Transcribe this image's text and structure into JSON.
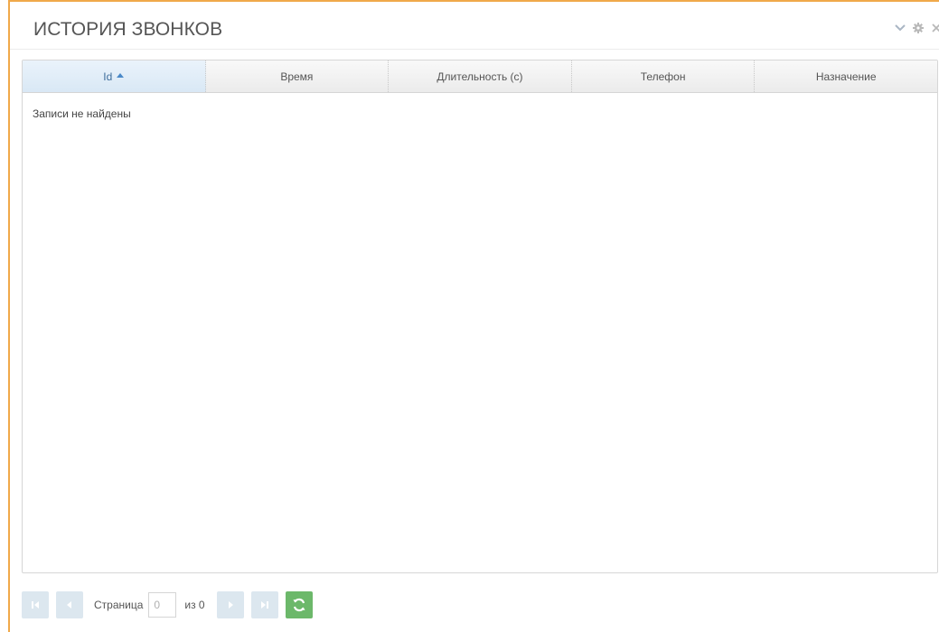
{
  "panel": {
    "title": "ИСТОРИЯ ЗВОНКОВ",
    "tools": [
      {
        "icon": "chevron-down-icon"
      },
      {
        "icon": "gear-icon"
      },
      {
        "icon": "close-icon"
      }
    ]
  },
  "grid": {
    "columns": [
      {
        "label": "Id",
        "sorted": "asc"
      },
      {
        "label": "Время"
      },
      {
        "label": "Длительность (с)"
      },
      {
        "label": "Телефон"
      },
      {
        "label": "Назначение"
      }
    ],
    "rows": [],
    "empty_message": "Записи не найдены"
  },
  "pager": {
    "page_label": "Страница",
    "page_value": "0",
    "of_label": "из 0",
    "buttons": {
      "first": "first-page-icon",
      "prev": "prev-page-icon",
      "next": "next-page-icon",
      "last": "last-page-icon",
      "refresh": "refresh-icon"
    }
  },
  "colors": {
    "accent_border": "#f0a94a",
    "sorted_header": "#d9e8f5",
    "pager_button": "#dce7ef",
    "refresh_button": "#6cb86a"
  }
}
